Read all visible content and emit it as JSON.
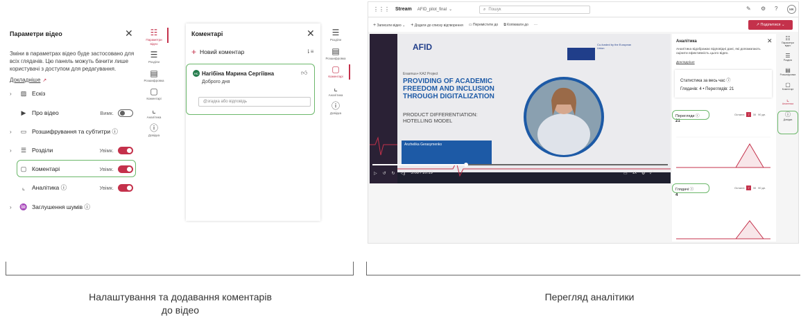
{
  "video_settings": {
    "title": "Параметри відео",
    "description": "Зміни в параметрах відео буде застосовано для всіх глядачів. Цю панель можуть бачити лише користувачі з доступом для редагування.",
    "learn_more": "Докладніше",
    "items": [
      {
        "label": "Ескіз",
        "state": "",
        "toggle": ""
      },
      {
        "label": "Про відео",
        "state": "Вимк.",
        "toggle": "off"
      },
      {
        "label": "Розшифрування та субтитри ⓘ",
        "state": "",
        "toggle": ""
      },
      {
        "label": "Розділи",
        "state": "Увімк.",
        "toggle": "on"
      },
      {
        "label": "Коментарі",
        "state": "Увімк.",
        "toggle": "on"
      },
      {
        "label": "Аналітика ⓘ",
        "state": "Увімк.",
        "toggle": "on"
      },
      {
        "label": "Заглушення шумів ⓘ",
        "state": "",
        "toggle": ""
      }
    ]
  },
  "rail_left": [
    "Параметри відео",
    "Розділи",
    "Розшифровка",
    "Коментарі",
    "Аналітика",
    "Довідка"
  ],
  "comments": {
    "title": "Коментарі",
    "new_comment": "Новий коментар",
    "author": "Нагібіна Марина Сергіївна",
    "initials": "НС",
    "text": "Доброго дня",
    "reply_placeholder": "@згадка або відповідь"
  },
  "rail_mid": [
    "Розділи",
    "Розшифровка",
    "Коментарі",
    "Аналітика",
    "Довідка"
  ],
  "stream": {
    "app": "Stream",
    "file": "AFID_pilot_final",
    "search_placeholder": "Пошук",
    "avatar": "MK",
    "toolbar": [
      "Записати відео",
      "Додати до списку відтворення",
      "Перемістити до",
      "Копіювати до",
      "···"
    ],
    "share": "Поділитися"
  },
  "video": {
    "logo": "AFID",
    "eu": "Co-funded by the European Union",
    "project": "Erasmus+ KA2 Project",
    "headline": "PROVIDING OF ACADEMIC FREEDOM AND INCLUSION THROUGH DIGITALIZATION",
    "subtitle": "PRODUCT DIFFERENTIATION: HOTELLING MODEL",
    "speaker": "Anzhelika Gerasymenko",
    "time": "3:08 / 10:19",
    "speed": "1x"
  },
  "analytics": {
    "title": "Аналітика",
    "description": "Аналітика відображає відповідні дані, які допомагають оцінити ефективність цього відео.",
    "learn_more": "Докладніше",
    "stats_title": "Статистика за весь час ⓘ",
    "stats_values": "Глядачів: 4 • Переглядів: 21",
    "views_label": "Перегляди ⓘ",
    "views_value": "21",
    "viewers_label": "Глядачі ⓘ",
    "viewers_value": "4",
    "range": "Останні",
    "ranges": [
      "7",
      "30",
      "90 дн."
    ]
  },
  "rail_right": [
    "Параметри відео",
    "Розділи",
    "Розшифровка",
    "Коментарі",
    "Аналітика",
    "Довідка"
  ],
  "captions": {
    "left": "Налаштування та додавання коментарів до відео",
    "right": "Перегляд аналітики"
  }
}
